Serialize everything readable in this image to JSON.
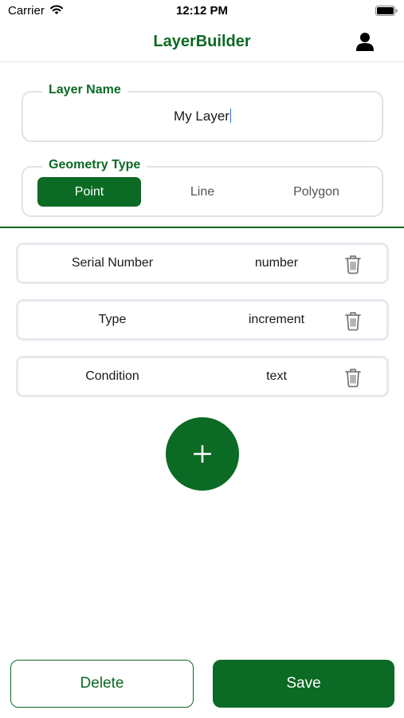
{
  "status_bar": {
    "carrier": "Carrier",
    "time": "12:12 PM"
  },
  "nav": {
    "title": "LayerBuilder",
    "profile_icon": "person-icon"
  },
  "layer_name": {
    "legend": "Layer Name",
    "value": "My Layer"
  },
  "geometry_type": {
    "legend": "Geometry Type",
    "options": [
      "Point",
      "Line",
      "Polygon"
    ],
    "selected": "Point"
  },
  "attributes": [
    {
      "name": "Serial Number",
      "type": "number"
    },
    {
      "name": "Type",
      "type": "increment"
    },
    {
      "name": "Condition",
      "type": "text"
    }
  ],
  "actions": {
    "delete_label": "Delete",
    "save_label": "Save"
  },
  "colors": {
    "accent": "#0b6a23",
    "selected_segment_text": "#ffffff",
    "field_border": "#e2e2e2"
  },
  "icons": {
    "add": "plus-icon",
    "remove": "trash-icon"
  }
}
